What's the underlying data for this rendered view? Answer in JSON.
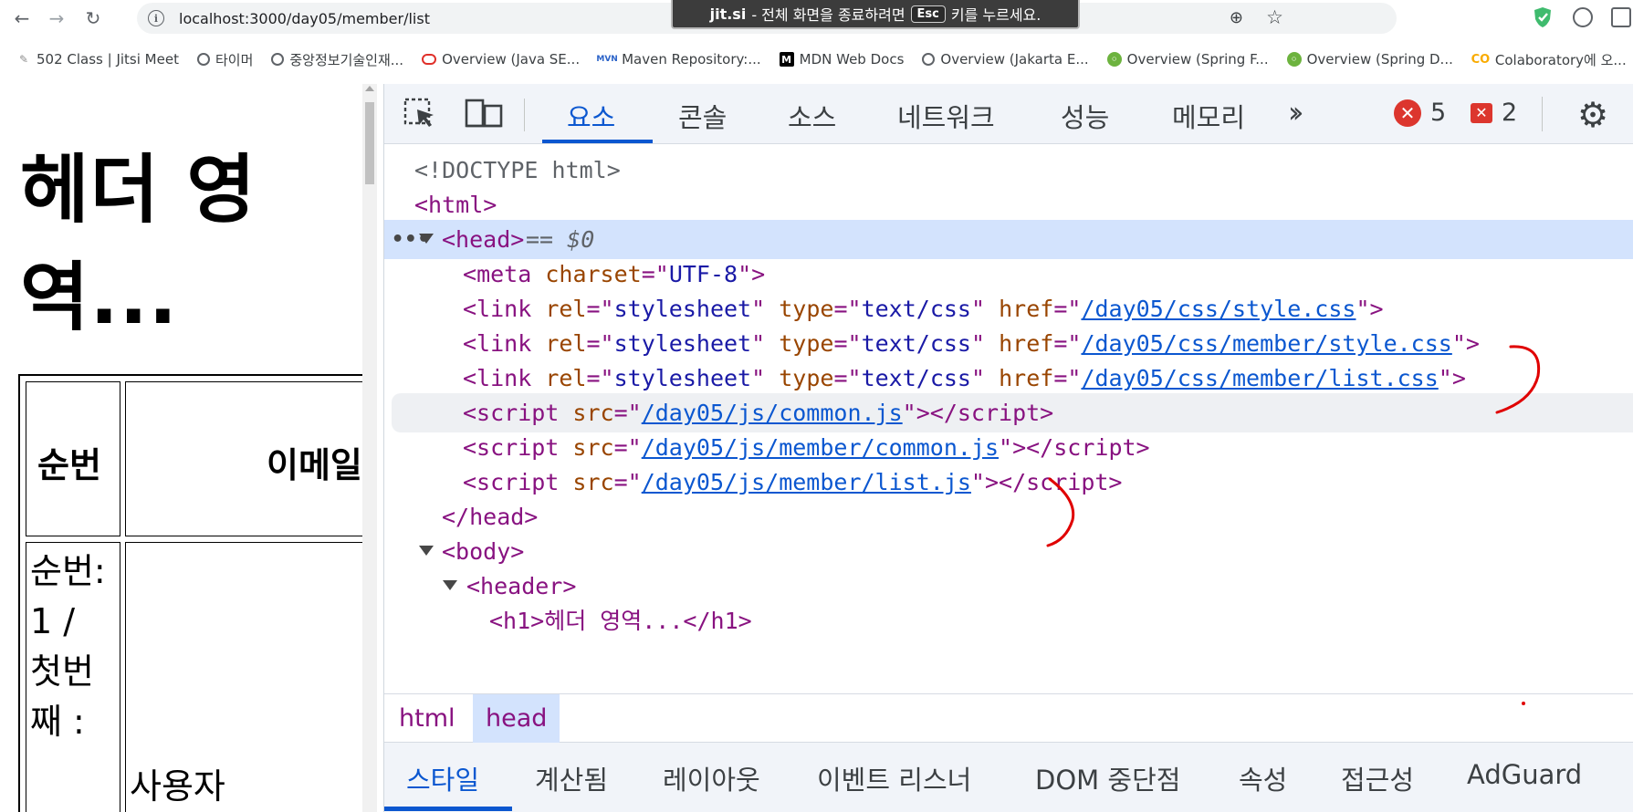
{
  "browser": {
    "url": "localhost:3000/day05/member/list",
    "fullscreen_toast": {
      "site": "jit.si",
      "before": "- 전체 화면을 종료하려면",
      "key": "Esc",
      "after": "키를 누르세요."
    },
    "bookmarks": [
      {
        "label": "502 Class | Jitsi Meet",
        "icon": "jitsi-icon"
      },
      {
        "label": "타이머",
        "icon": "globe-icon"
      },
      {
        "label": "중앙정보기술인재...",
        "icon": "globe-icon"
      },
      {
        "label": "Overview (Java SE...",
        "icon": "oracle-icon"
      },
      {
        "label": "Maven Repository:...",
        "icon": "maven-icon"
      },
      {
        "label": "MDN Web Docs",
        "icon": "mdn-icon"
      },
      {
        "label": "Overview (Jakarta E...",
        "icon": "globe-icon"
      },
      {
        "label": "Overview (Spring F...",
        "icon": "spring-icon"
      },
      {
        "label": "Overview (Spring D...",
        "icon": "spring-icon"
      },
      {
        "label": "Colaboratory에 오...",
        "icon": "colab-icon"
      }
    ]
  },
  "page": {
    "h1": "헤더 영역...",
    "table_headers": [
      "순번",
      "이메일"
    ],
    "row1_cell1": "순번:1 / 첫번째 :",
    "row1_cell2": "사용자"
  },
  "devtools": {
    "tabs": [
      "요소",
      "콘솔",
      "소스",
      "네트워크",
      "성능",
      "메모리"
    ],
    "active_tab": "요소",
    "error_count": "5",
    "warning_count": "2",
    "tree": {
      "doctype": "<!DOCTYPE html>",
      "html_open": "<html>",
      "head_open": "<head>",
      "selected_marker": "== $0",
      "meta": {
        "tag": "meta",
        "attr": "charset",
        "value": "UTF-8"
      },
      "links": [
        {
          "rel": "stylesheet",
          "type": "text/css",
          "href": "/day05/css/style.css"
        },
        {
          "rel": "stylesheet",
          "type": "text/css",
          "href": "/day05/css/member/style.css"
        },
        {
          "rel": "stylesheet",
          "type": "text/css",
          "href": "/day05/css/member/list.css"
        }
      ],
      "scripts": [
        {
          "src": "/day05/js/common.js"
        },
        {
          "src": "/day05/js/member/common.js"
        },
        {
          "src": "/day05/js/member/list.js"
        }
      ],
      "head_close": "</head>",
      "body_open": "<body>",
      "header_open": "<header>",
      "h1_line": "<h1>헤더 영역...</h1>"
    },
    "breadcrumbs": [
      "html",
      "head"
    ],
    "lower_tabs": [
      "스타일",
      "계산됨",
      "레이아웃",
      "이벤트 리스너",
      "DOM 중단점",
      "속성",
      "접근성",
      "AdGuard"
    ],
    "active_lower_tab": "스타일"
  },
  "colors": {
    "accent": "#0b57d0",
    "selected_row": "#d3e3fd",
    "tag": "#881280",
    "attr_name": "#994500",
    "annotation": "#e00000"
  }
}
